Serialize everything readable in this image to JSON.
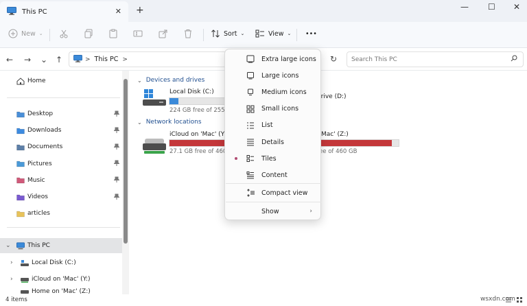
{
  "window": {
    "tab_title": "This PC",
    "tab_close": "✕",
    "new_tab": "+",
    "minimize": "—",
    "maximize": "☐",
    "close": "✕"
  },
  "toolbar": {
    "new_label": "New",
    "sort_label": "Sort",
    "view_label": "View",
    "more_label": "•••",
    "chevron": "⌄"
  },
  "address": {
    "back": "←",
    "forward": "→",
    "recent": "⌄",
    "up": "↑",
    "crumb": "This PC",
    "crumb_sep": ">",
    "refresh": "↻",
    "search_placeholder": "Search This PC"
  },
  "sidebar": {
    "home": "Home",
    "quick_access": [
      {
        "label": "Desktop",
        "color": "#4a8fd8"
      },
      {
        "label": "Downloads",
        "color": "#3d8be0"
      },
      {
        "label": "Documents",
        "color": "#5d7fa8"
      },
      {
        "label": "Pictures",
        "color": "#4a9ad8"
      },
      {
        "label": "Music",
        "color": "#d05a7a"
      },
      {
        "label": "Videos",
        "color": "#7a5ad0"
      },
      {
        "label": "articles",
        "color": "#e8c35a"
      }
    ],
    "pin_glyph": "📌",
    "this_pc": "This PC",
    "drives": [
      {
        "label": "Local Disk (C:)"
      },
      {
        "label": "iCloud on 'Mac' (Y:)"
      },
      {
        "label": "Home on 'Mac' (Z:)"
      }
    ],
    "expand_glyph": "›",
    "expanded_glyph": "⌄"
  },
  "content": {
    "devices_header": "Devices and drives",
    "network_header": "Network locations",
    "group_chevron": "⌄",
    "local_c": {
      "name": "Local Disk (C:)",
      "free": "224 GB free of 255 GB",
      "used_fraction": 0.12
    },
    "drive_d": {
      "name": "DVD Drive (D:)"
    },
    "icloud_y": {
      "name": "iCloud on 'Mac' (Y:)",
      "free": "27.1 GB free of 460 GB",
      "used_fraction": 0.94
    },
    "home_z": {
      "name": "Home on 'Mac' (Z:)",
      "free": "27.1 GB free of 460 GB",
      "used_fraction": 0.94
    }
  },
  "status": {
    "items": "4 items"
  },
  "view_menu": {
    "items": [
      {
        "label": "Extra large icons",
        "icon": "extra-large-icons-icon"
      },
      {
        "label": "Large icons",
        "icon": "large-icons-icon"
      },
      {
        "label": "Medium icons",
        "icon": "medium-icons-icon"
      },
      {
        "label": "Small icons",
        "icon": "small-icons-icon"
      },
      {
        "label": "List",
        "icon": "list-icon"
      },
      {
        "label": "Details",
        "icon": "details-icon"
      },
      {
        "label": "Tiles",
        "icon": "tiles-icon",
        "selected": true
      },
      {
        "label": "Content",
        "icon": "content-icon"
      }
    ],
    "compact_view": "Compact view",
    "show": "Show",
    "submenu_chevron": "›"
  },
  "watermark": "wsxdn.com",
  "colors": {
    "accent_bar": "#3b8ad9",
    "full_bar": "#c4373a",
    "selected_dot": "#b14c72"
  }
}
